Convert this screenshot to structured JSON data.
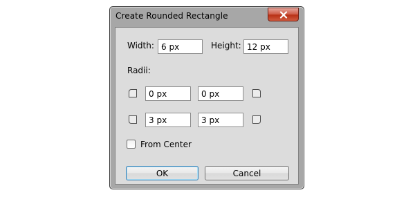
{
  "window": {
    "title": "Create Rounded Rectangle"
  },
  "size": {
    "width_label": "Width:",
    "width_value": "6 px",
    "height_label": "Height:",
    "height_value": "12 px"
  },
  "radii": {
    "label": "Radii:",
    "top_left": "0 px",
    "top_right": "0 px",
    "bottom_left": "3 px",
    "bottom_right": "3 px"
  },
  "options": {
    "from_center_label": "From Center",
    "from_center_checked": false
  },
  "buttons": {
    "ok_label": "OK",
    "cancel_label": "Cancel"
  },
  "icons": {
    "close": "close-icon",
    "top_left": "top-left-corner-icon",
    "top_right": "top-right-corner-icon",
    "bottom_left": "bottom-left-corner-icon",
    "bottom_right": "bottom-right-corner-icon"
  },
  "colors": {
    "close_button": "#c7432a",
    "dialog_background": "#dcdcdc",
    "frame": "#a7a7a7",
    "default_button_border": "#3c7fb1"
  }
}
